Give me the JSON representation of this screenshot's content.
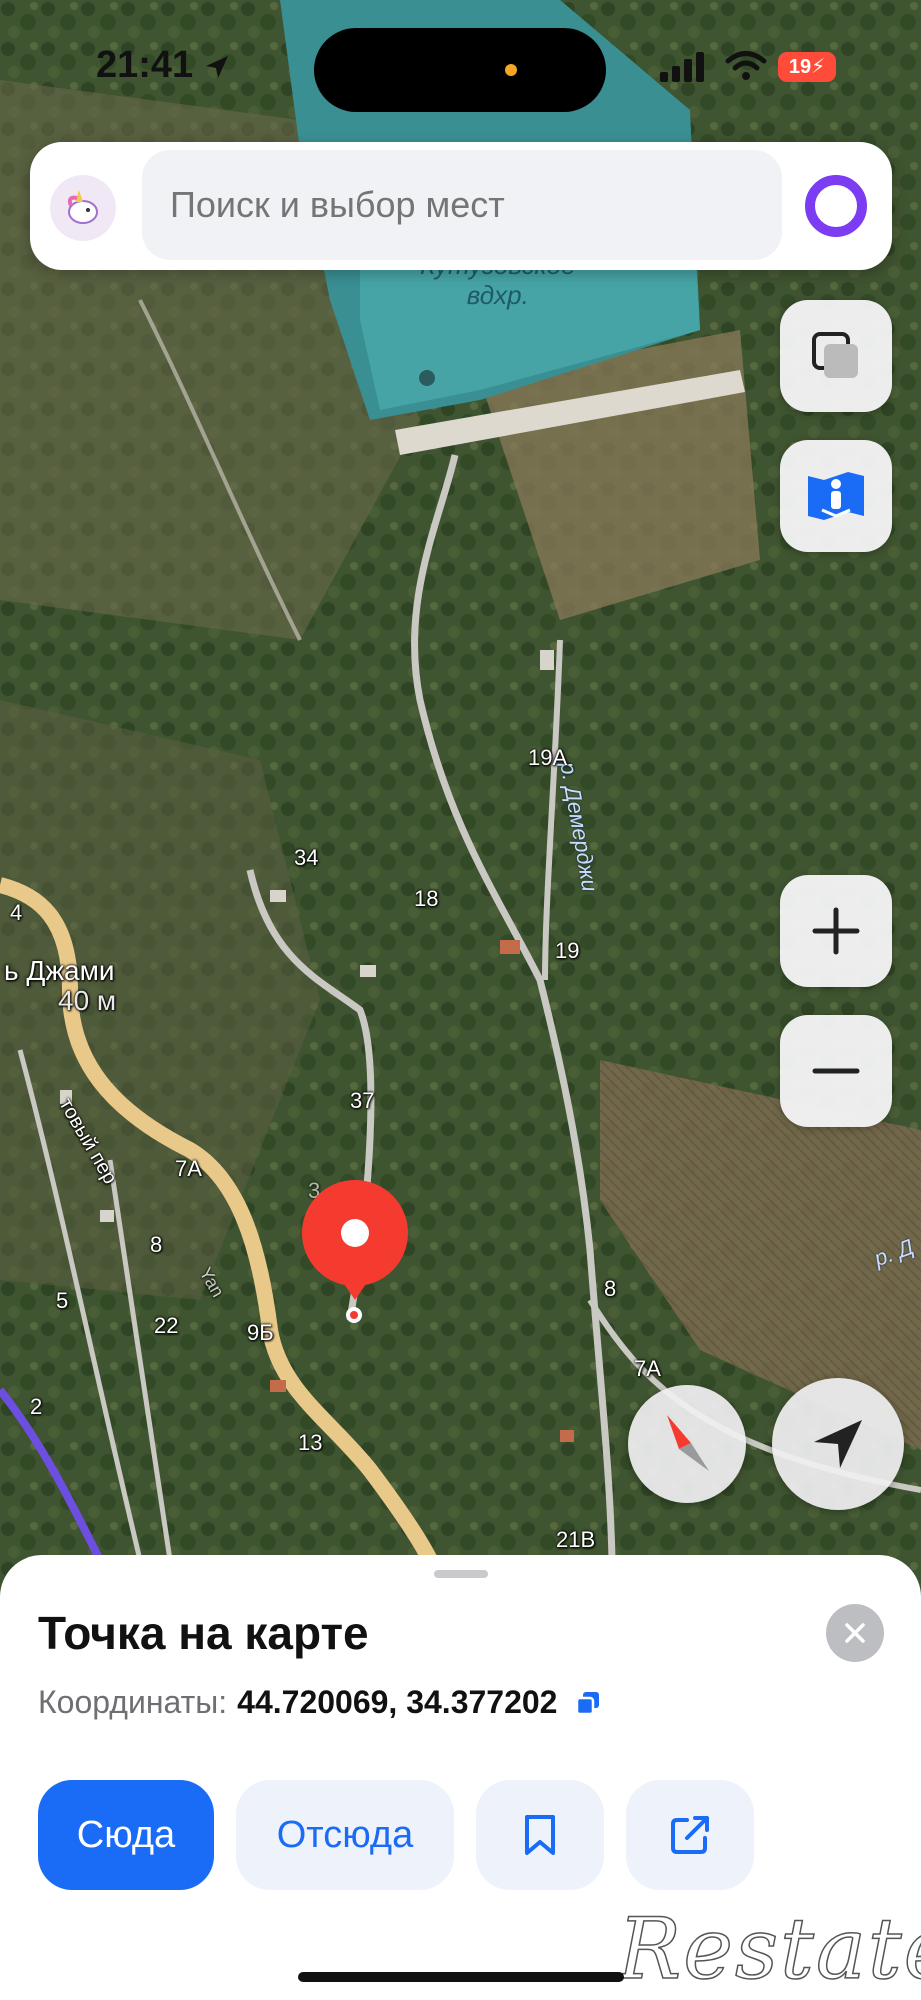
{
  "status_bar": {
    "time": "21:41",
    "battery": "19"
  },
  "search": {
    "placeholder": "Поиск и выбор мест"
  },
  "map": {
    "labels": {
      "reservoir": "Кутузовское\nвдхр.",
      "river_1": "р. Демерджи",
      "river_2": "р. Д",
      "place": "ь Джами",
      "elevation": "40 м",
      "street": "товый пер",
      "road": "Yan",
      "h_19a": "19А",
      "h_34": "34",
      "h_18": "18",
      "h_19": "19",
      "h_4": "4",
      "h_37": "37",
      "h_7a_left": "7А",
      "h_8_left": "8",
      "h_5": "5",
      "h_22": "22",
      "h_9b": "9Б",
      "h_2": "2",
      "h_13": "13",
      "h_8_right": "8",
      "h_7a_right": "7А",
      "h_21v": "21В",
      "h_3": "3"
    },
    "icons": {
      "layers": "layers-icon",
      "panorama": "panorama-icon",
      "zoom_in": "plus-icon",
      "zoom_out": "minus-icon",
      "compass": "compass-icon",
      "location": "navigation-arrow-icon"
    }
  },
  "sheet": {
    "title": "Точка на карте",
    "coords_label": "Координаты:",
    "coords_value": "44.720069, 34.377202",
    "buttons": {
      "to_here": "Сюда",
      "from_here": "Отсюда"
    }
  },
  "watermark": "Restate",
  "colors": {
    "accent": "#1a6cf7",
    "pin": "#f53b30",
    "road": "#e9c98a"
  }
}
